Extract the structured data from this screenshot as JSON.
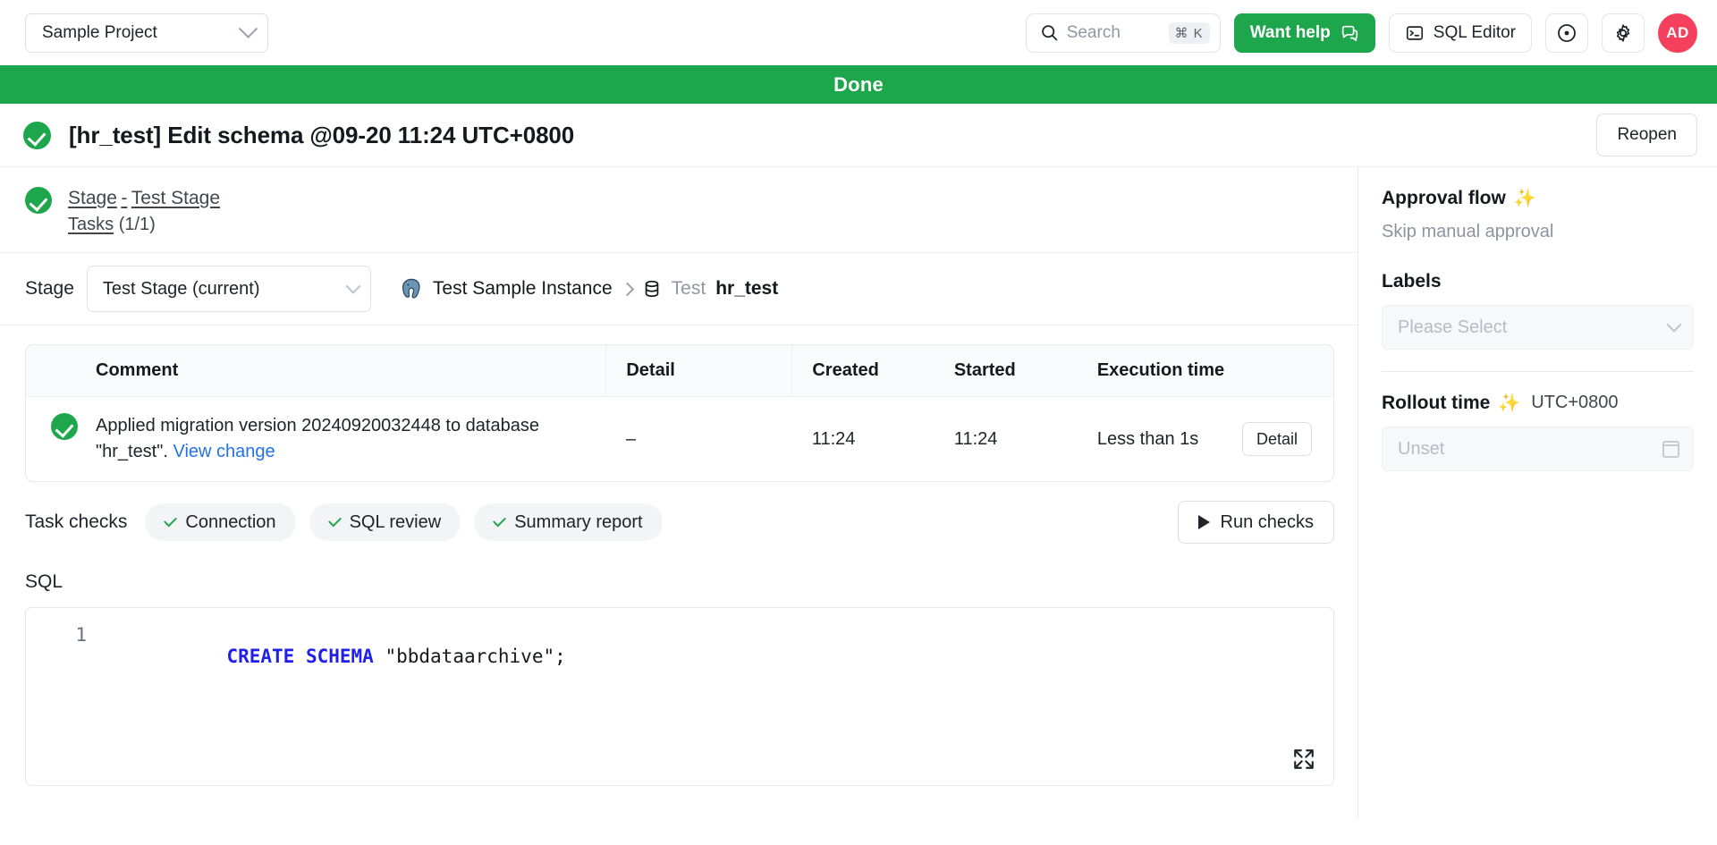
{
  "topbar": {
    "project": "Sample Project",
    "project_chevron_icon": "chevron-down-icon",
    "search_placeholder": "Search",
    "search_shortcut": "⌘ K",
    "want_help_label": "Want help",
    "want_help_icon": "chat-bubble-icon",
    "sql_editor_label": "SQL Editor",
    "sql_editor_icon": "terminal-icon",
    "circle_dot_icon": "circle-dot-icon",
    "gear_icon": "gear-icon",
    "avatar_initials": "AD",
    "avatar_color": "#f4405c"
  },
  "banner": {
    "text": "Done",
    "color": "#1ea64d"
  },
  "header": {
    "status_icon": "check-circle-icon",
    "title": "[hr_test] Edit schema @09-20 11:24 UTC+0800",
    "reopen_label": "Reopen"
  },
  "stage_summary": {
    "status_icon": "check-circle-icon",
    "stage_link": "Stage",
    "dash": "-",
    "stage_name": "Test Stage",
    "tasks_link": "Tasks",
    "tasks_count": "(1/1)"
  },
  "stage_row": {
    "label": "Stage",
    "selected": "Test Stage (current)",
    "chevron_icon": "chevron-down-icon",
    "instance_icon": "postgres-elephant-icon",
    "instance": "Test Sample Instance",
    "separator_icon": "chevron-right-icon",
    "database_icon": "database-icon",
    "env": "Test",
    "database": "hr_test"
  },
  "task_table": {
    "columns": [
      "Comment",
      "Detail",
      "Created",
      "Started",
      "Execution time"
    ],
    "rows": [
      {
        "status_icon": "check-circle-icon",
        "comment_line1": "Applied migration version 20240920032448",
        "comment_line2": "to database \"hr_test\".",
        "comment_link": "View change",
        "detail": "–",
        "created": "11:24",
        "started": "11:24",
        "execution_time": "Less than 1s",
        "action_label": "Detail"
      }
    ]
  },
  "task_checks": {
    "label": "Task checks",
    "items": [
      {
        "label": "Connection",
        "icon": "check-icon"
      },
      {
        "label": "SQL review",
        "icon": "check-icon"
      },
      {
        "label": "Summary report",
        "icon": "check-icon"
      }
    ],
    "run_label": "Run checks",
    "run_icon": "play-icon"
  },
  "sql": {
    "label": "SQL",
    "line_number": "1",
    "keyword": "CREATE SCHEMA",
    "rest": " \"bbdataarchive\";",
    "expand_icon": "expand-icon"
  },
  "sidebar": {
    "approval_title": "Approval flow",
    "approval_icon": "sparkles-icon",
    "approval_value": "Skip manual approval",
    "labels_title": "Labels",
    "labels_placeholder": "Please Select",
    "labels_chevron_icon": "chevron-down-icon",
    "rollout_title": "Rollout time",
    "rollout_icon": "sparkles-icon",
    "rollout_tz": "UTC+0800",
    "rollout_placeholder": "Unset",
    "rollout_calendar_icon": "calendar-icon",
    "accent_purple": "#4a3fe0"
  }
}
